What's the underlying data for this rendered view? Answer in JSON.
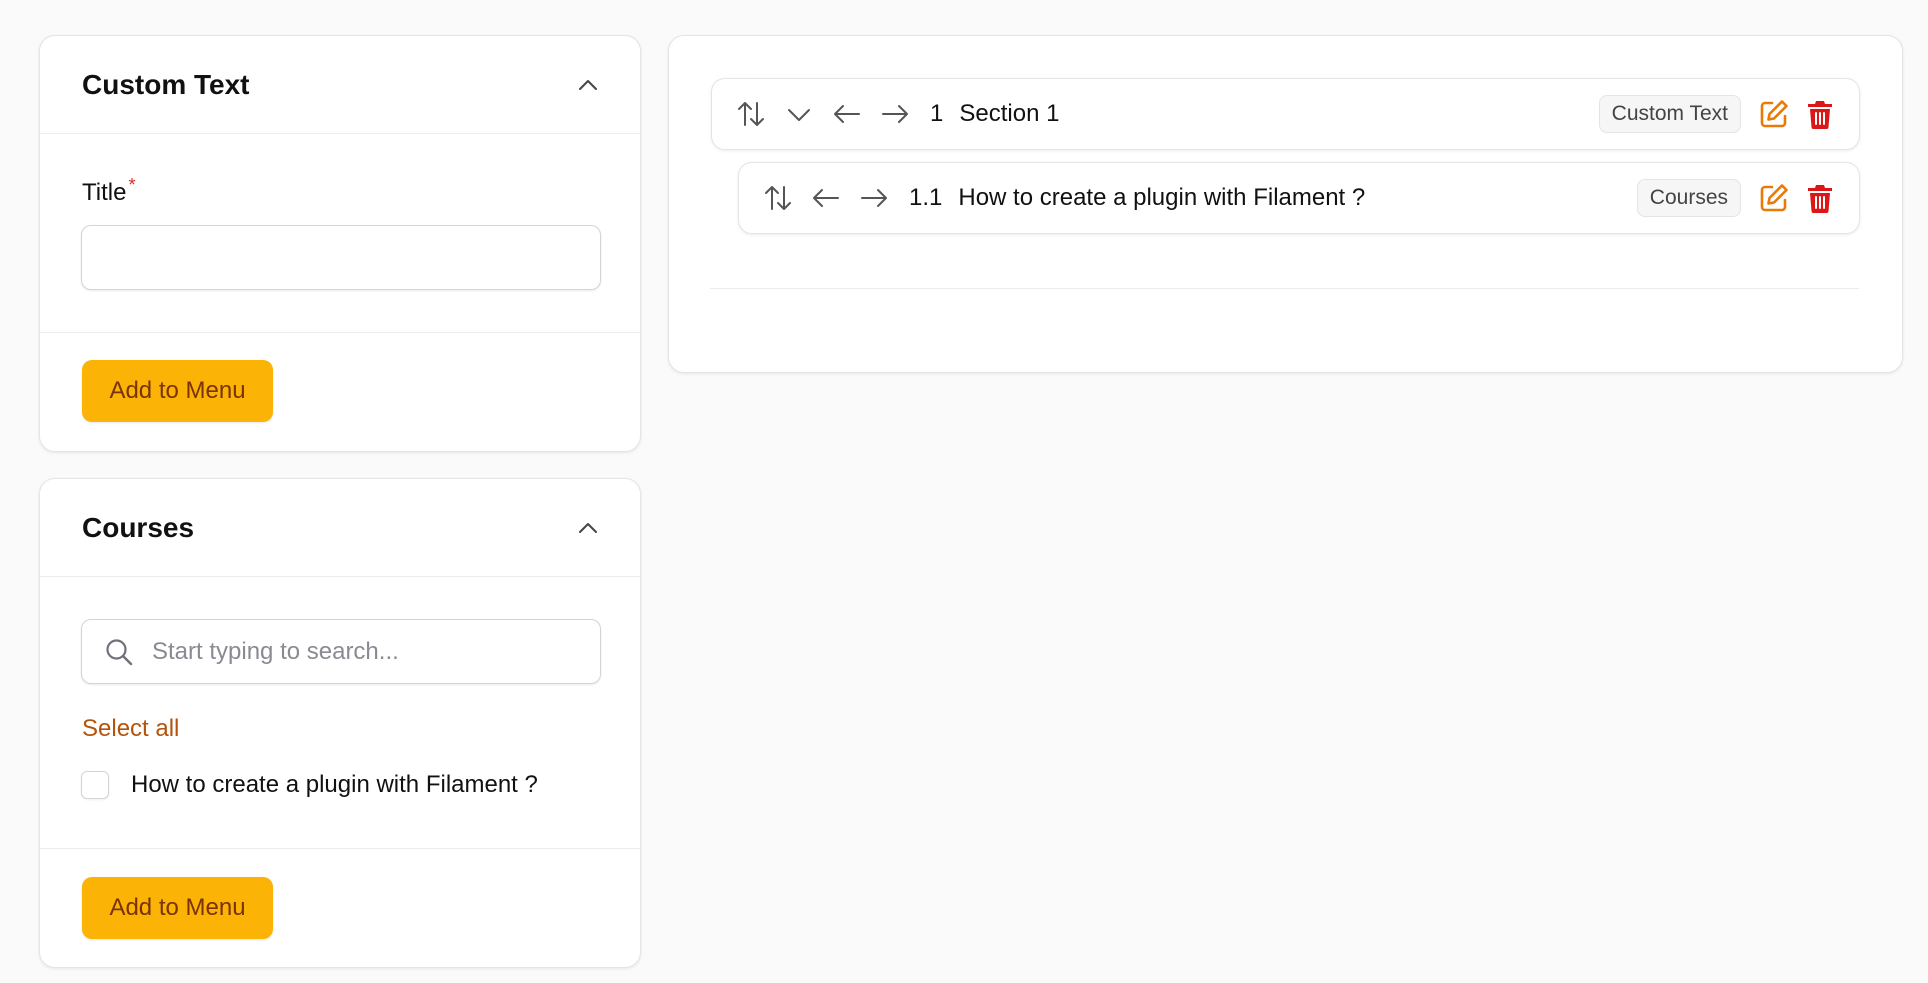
{
  "custom_text_panel": {
    "title": "Custom Text",
    "title_field_label": "Title",
    "required_marker": "*",
    "title_field_value": "",
    "title_field_placeholder": "",
    "add_button": "Add to Menu"
  },
  "courses_panel": {
    "title": "Courses",
    "search_placeholder": "Start typing to search...",
    "select_all": "Select all",
    "items": [
      {
        "label": "How to create a plugin with Filament ?",
        "checked": false
      }
    ],
    "add_button": "Add to Menu"
  },
  "menu_tree": {
    "items": [
      {
        "number": "1",
        "title": "Section 1",
        "type_badge": "Custom Text"
      },
      {
        "number": "1.1",
        "title": "How to create a plugin with Filament ?",
        "type_badge": "Courses"
      }
    ]
  },
  "colors": {
    "accent": "#fbb305",
    "accent_text": "#7a3306",
    "link": "#b45309",
    "edit_icon": "#ea7a06",
    "delete_icon": "#dc1616",
    "required": "#dc2626"
  },
  "icons": {
    "collapse": "chevron-up-icon",
    "reorder": "arrows-up-down-icon",
    "expand": "chevron-down-icon",
    "outdent": "arrow-left-icon",
    "indent": "arrow-right-icon",
    "edit": "pencil-square-icon",
    "delete": "trash-icon",
    "search": "search-icon"
  }
}
